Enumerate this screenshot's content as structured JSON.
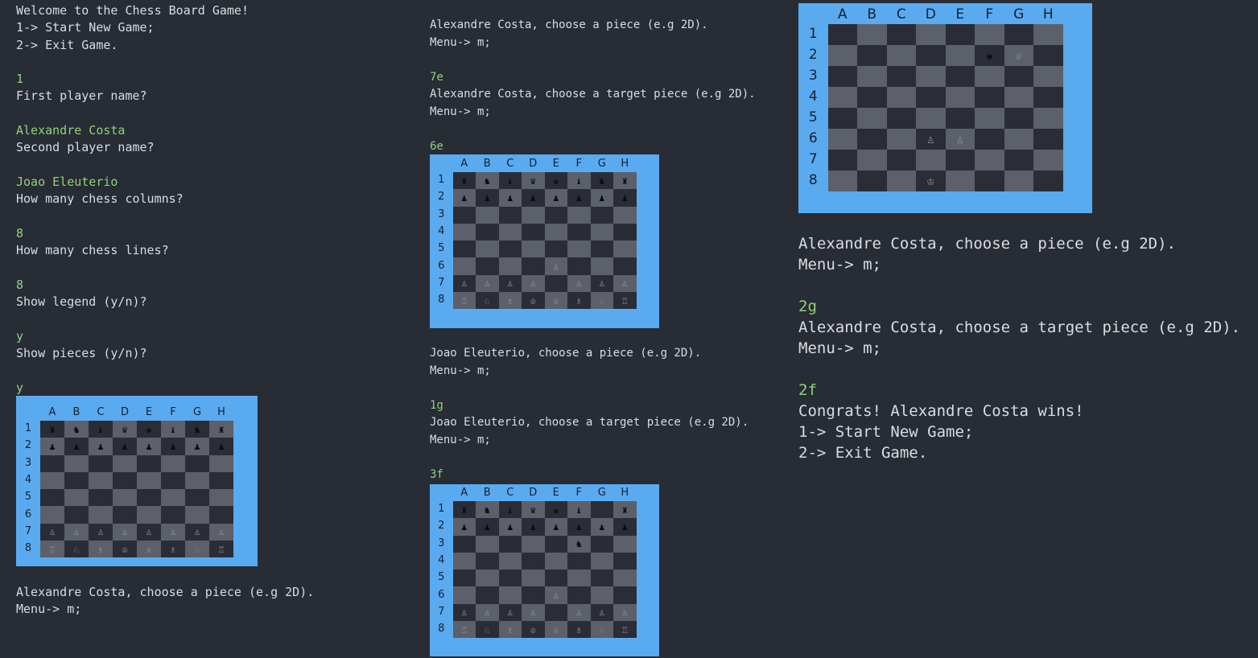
{
  "columns": [
    "A",
    "B",
    "C",
    "D",
    "E",
    "F",
    "G",
    "H"
  ],
  "rows": [
    "1",
    "2",
    "3",
    "4",
    "5",
    "6",
    "7",
    "8"
  ],
  "terminal_col1": [
    {
      "t": "Welcome to the Chess Board Game!",
      "k": "out"
    },
    {
      "t": "1-> Start New Game;",
      "k": "out"
    },
    {
      "t": "2-> Exit Game.",
      "k": "out"
    },
    {
      "t": "",
      "k": "blank"
    },
    {
      "t": "1",
      "k": "in"
    },
    {
      "t": "First player name?",
      "k": "out"
    },
    {
      "t": "",
      "k": "blank"
    },
    {
      "t": "Alexandre Costa",
      "k": "in"
    },
    {
      "t": "Second player name?",
      "k": "out"
    },
    {
      "t": "",
      "k": "blank"
    },
    {
      "t": "Joao Eleuterio",
      "k": "in"
    },
    {
      "t": "How many chess columns?",
      "k": "out"
    },
    {
      "t": "",
      "k": "blank"
    },
    {
      "t": "8",
      "k": "in"
    },
    {
      "t": "How many chess lines?",
      "k": "out"
    },
    {
      "t": "",
      "k": "blank"
    },
    {
      "t": "8",
      "k": "in"
    },
    {
      "t": "Show legend (y/n)?",
      "k": "out"
    },
    {
      "t": "",
      "k": "blank"
    },
    {
      "t": "y",
      "k": "in"
    },
    {
      "t": "Show pieces (y/n)?",
      "k": "out"
    },
    {
      "t": "",
      "k": "blank"
    },
    {
      "t": "y",
      "k": "in"
    }
  ],
  "terminal_col1_after": [
    {
      "t": "Alexandre Costa, choose a piece (e.g 2D).",
      "k": "out"
    },
    {
      "t": "Menu-> m;",
      "k": "out"
    }
  ],
  "terminal_col2_a": [
    {
      "t": "Alexandre Costa, choose a piece (e.g 2D).",
      "k": "out"
    },
    {
      "t": "Menu-> m;",
      "k": "out"
    },
    {
      "t": "",
      "k": "blank"
    },
    {
      "t": "7e",
      "k": "in"
    },
    {
      "t": "Alexandre Costa, choose a target piece (e.g 2D).",
      "k": "out"
    },
    {
      "t": "Menu-> m;",
      "k": "out"
    },
    {
      "t": "",
      "k": "blank"
    },
    {
      "t": "6e",
      "k": "in"
    }
  ],
  "terminal_col2_b": [
    {
      "t": "Joao Eleuterio, choose a piece (e.g 2D).",
      "k": "out"
    },
    {
      "t": "Menu-> m;",
      "k": "out"
    },
    {
      "t": "",
      "k": "blank"
    },
    {
      "t": "1g",
      "k": "in"
    },
    {
      "t": "Joao Eleuterio, choose a target piece (e.g 2D).",
      "k": "out"
    },
    {
      "t": "Menu-> m;",
      "k": "out"
    },
    {
      "t": "",
      "k": "blank"
    },
    {
      "t": "3f",
      "k": "in"
    }
  ],
  "terminal_col3": [
    {
      "t": "Alexandre Costa, choose a piece (e.g 2D).",
      "k": "out"
    },
    {
      "t": "Menu-> m;",
      "k": "out"
    },
    {
      "t": "",
      "k": "blank"
    },
    {
      "t": "2g",
      "k": "in"
    },
    {
      "t": "Alexandre Costa, choose a target piece (e.g 2D).",
      "k": "out"
    },
    {
      "t": "Menu-> m;",
      "k": "out"
    },
    {
      "t": "",
      "k": "blank"
    },
    {
      "t": "2f",
      "k": "in"
    },
    {
      "t": "Congrats! Alexandre Costa wins!",
      "k": "out"
    },
    {
      "t": "1-> Start New Game;",
      "k": "out"
    },
    {
      "t": "2-> Exit Game.",
      "k": "out"
    }
  ],
  "boards": {
    "initial": [
      "♜♞♝♛♚♝♞♜",
      "♟♟♟♟♟♟♟♟",
      "        ",
      "        ",
      "        ",
      "        ",
      "♙♙♙♙♙♙♙♙",
      "♖♘♗♔♕♗♘♖"
    ],
    "after_6e": [
      "♜♞♝♛♚♝♞♜",
      "♟♟♟♟♟♟♟♟",
      "        ",
      "        ",
      "        ",
      "    ♙   ",
      "♙♙♙♙ ♙♙♙",
      "♖♘♗♔♕♗♘♖"
    ],
    "after_3f": [
      "♜♞♝♛♚♝ ♜",
      "♟♟♟♟♟♟♟♟",
      "     ♞  ",
      "        ",
      "        ",
      "    ♙   ",
      "♙♙♙♙ ♙♙♙",
      "♖♘♗♔♕♗♘♖"
    ],
    "final": [
      "        ",
      "     ♚♕ ",
      "        ",
      "        ",
      "        ",
      "   ♙♙   ",
      "        ",
      "   ♔    "
    ]
  },
  "colors": {
    "background": "#272c35",
    "text": "#dadde2",
    "input_text": "#8fd37a",
    "board_frame": "#5aaaf0",
    "dark_square": "#2a2d35",
    "light_square": "#5b606a"
  }
}
